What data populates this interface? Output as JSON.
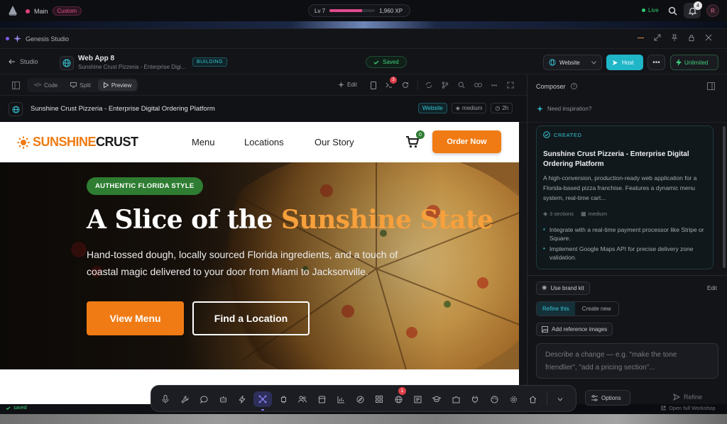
{
  "topbar": {
    "branch_label": "Main",
    "branch_badge": "Custom",
    "level": "Lv 7",
    "xp": "1,960 XP",
    "xp_progress": 0.72,
    "live_label": "Live",
    "notif_count": "4",
    "avatar_initial": "R"
  },
  "window": {
    "title": "Genesis Studio"
  },
  "project": {
    "back_label": "Studio",
    "name": "Web App 8",
    "subtitle": "Sunshine Crust Pizzeria - Enterprise Digi...",
    "status": "BUILDING",
    "saved": "Saved",
    "target": "Website",
    "host": "Host",
    "plan": "Unlimited"
  },
  "viewtabs": {
    "code": "Code",
    "split": "Split",
    "preview": "Preview",
    "edit": "Edit",
    "badge": "3"
  },
  "preview_bar": {
    "title": "Sunshine Crust Pizzeria - Enterprise Digital Ordering Platform",
    "type": "Website",
    "complexity": "medium",
    "time": "2h"
  },
  "site": {
    "logo_a": "SUNSHINE",
    "logo_b": "CRUST",
    "nav": [
      "Menu",
      "Locations",
      "Our Story"
    ],
    "cart_count": "0",
    "order_btn": "Order Now",
    "tag": "AUTHENTIC FLORIDA STYLE",
    "headline_a": "A Slice of the ",
    "headline_b": "Sunshine State",
    "body": "Hand-tossed dough, locally sourced Florida ingredients, and a touch of coastal magic delivered to your door from Miami to Jacksonville.",
    "cta_primary": "View Menu",
    "cta_secondary": "Find a Location"
  },
  "composer": {
    "title": "Composer",
    "inspiration": "Need inspiration?",
    "card_status": "CREATED",
    "card_title": "Sunshine Crust Pizzeria - Enterprise Digital Ordering Platform",
    "card_desc": "A high-conversion, production-ready web application for a Florida-based pizza franchise. Features a dynamic menu system, real-time cart...",
    "sections": "3 sections",
    "complexity": "medium",
    "bullets": [
      "Integrate with a real-time payment processor like Stripe or Square.",
      "Implement Google Maps API for precise delivery zone validation."
    ],
    "brand_kit": "Use brand kit",
    "edit": "Edit",
    "refine_tab": "Refine this",
    "create_tab": "Create new",
    "add_ref": "Add reference images",
    "placeholder": "Describe a change — e.g. \"make the tone friendlier\", \"add a pricing section\"...",
    "options": "Options",
    "refine_btn": "Refine",
    "open_workshop": "Open full Workshop"
  },
  "status": {
    "saved": "saved"
  },
  "dock": {
    "badge": "1"
  }
}
